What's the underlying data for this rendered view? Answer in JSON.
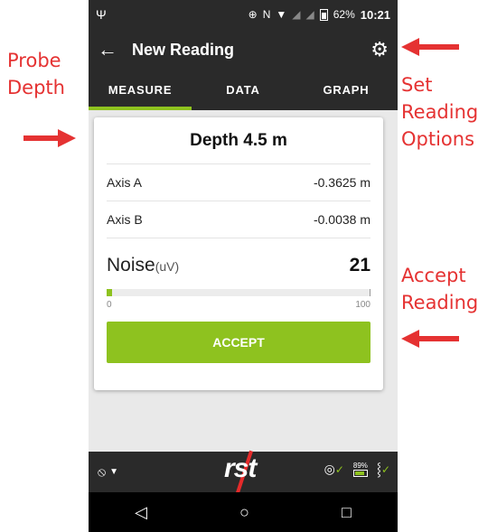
{
  "annotations": {
    "probe_depth": "Probe Depth",
    "set_reading_options": "Set Reading Options",
    "accept_reading": "Accept Reading"
  },
  "statusbar": {
    "battery": "62%",
    "time": "10:21"
  },
  "appbar": {
    "title": "New Reading",
    "back_icon": "arrow-left-icon",
    "settings_icon": "gear-icon"
  },
  "tabs": [
    {
      "label": "MEASURE",
      "active": true
    },
    {
      "label": "DATA",
      "active": false
    },
    {
      "label": "GRAPH",
      "active": false
    }
  ],
  "card": {
    "depth": "Depth 4.5 m",
    "axis_a": {
      "label": "Axis A",
      "value": "-0.3625 m"
    },
    "axis_b": {
      "label": "Axis B",
      "value": "-0.0038 m"
    },
    "noise": {
      "label": "Noise",
      "unit": "(uV)",
      "value": "21",
      "fraction": 0.02
    },
    "scale_min": "0",
    "scale_max": "100",
    "accept_label": "ACCEPT"
  },
  "bottombar": {
    "logo": "rst",
    "device_battery": "89%"
  },
  "colors": {
    "accent": "#8ec21f",
    "bar": "#2a2a2a",
    "annotation": "#e53232"
  }
}
